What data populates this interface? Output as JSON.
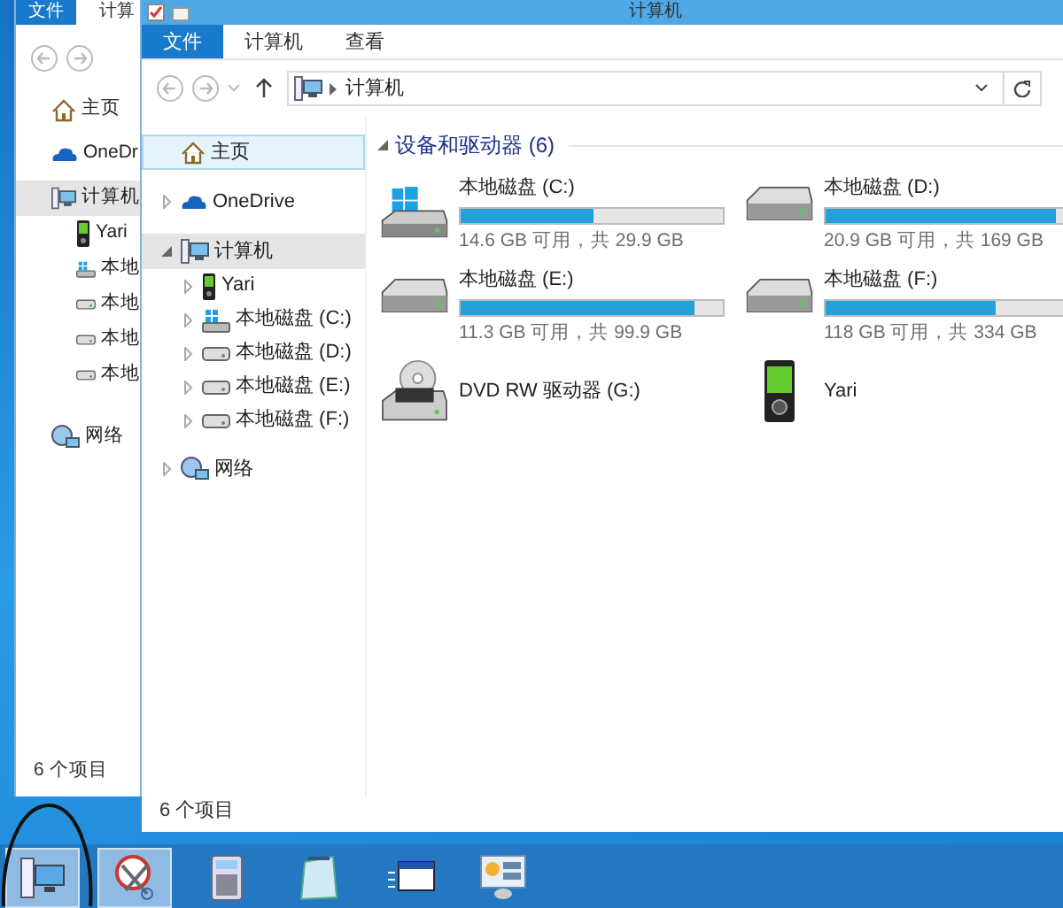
{
  "back_window": {
    "ribbon_tabs": [
      {
        "label": "文件",
        "selected": true
      },
      {
        "label": "计算",
        "selected": false
      }
    ],
    "nav_items": [
      {
        "label": "主页",
        "kind": "home",
        "selected": false
      },
      {
        "label": "OneDr",
        "kind": "cloud",
        "selected": false
      },
      {
        "label": "计算机",
        "kind": "computer",
        "selected": true,
        "children": [
          {
            "label": "Yari",
            "kind": "phone",
            "selected": false
          },
          {
            "label": "本地",
            "kind": "system-drive",
            "selected": false
          },
          {
            "label": "本地",
            "kind": "drive",
            "selected": false
          },
          {
            "label": "本地",
            "kind": "drive",
            "selected": false
          },
          {
            "label": "本地",
            "kind": "drive",
            "selected": false
          }
        ]
      },
      {
        "label": "网络",
        "kind": "network",
        "selected": false
      }
    ],
    "status": "6 个项目"
  },
  "window": {
    "title": "计算机",
    "ribbon_tabs": [
      {
        "label": "文件",
        "selected": true
      },
      {
        "label": "计算机",
        "selected": false
      },
      {
        "label": "查看",
        "selected": false
      }
    ],
    "address": "计算机",
    "nav_tree": [
      {
        "label": "主页",
        "kind": "home",
        "selected": true,
        "hovered": false
      },
      {
        "label": "OneDrive",
        "kind": "cloud",
        "selected": false,
        "hovered": false,
        "expanded": false
      },
      {
        "label": "计算机",
        "kind": "computer",
        "selected": false,
        "hovered": true,
        "expanded": true,
        "children": [
          {
            "label": "Yari",
            "kind": "phone",
            "selected": false,
            "hovered": false,
            "expanded": false
          },
          {
            "label": "本地磁盘 (C:)",
            "kind": "system-drive",
            "selected": false,
            "hovered": false,
            "expanded": false
          },
          {
            "label": "本地磁盘 (D:)",
            "kind": "drive",
            "selected": false,
            "hovered": false,
            "expanded": false
          },
          {
            "label": "本地磁盘 (E:)",
            "kind": "drive",
            "selected": false,
            "hovered": false,
            "expanded": false
          },
          {
            "label": "本地磁盘 (F:)",
            "kind": "drive",
            "selected": false,
            "hovered": false,
            "expanded": false
          }
        ]
      },
      {
        "label": "网络",
        "kind": "network",
        "selected": false,
        "hovered": false,
        "expanded": false
      }
    ],
    "section": {
      "title": "设备和驱动器 (6)",
      "expanded": true
    },
    "drives": [
      {
        "kind": "system-disk",
        "name": "本地磁盘 (C:)",
        "level": 0.51,
        "info": "14.6 GB 可用，共 29.9 GB"
      },
      {
        "kind": "disk",
        "name": "本地磁盘 (D:)",
        "level": 0.88,
        "info": "20.9 GB 可用，共 169 GB"
      },
      {
        "kind": "disk",
        "name": "本地磁盘 (E:)",
        "level": 0.89,
        "info": "11.3 GB 可用，共 99.9 GB"
      },
      {
        "kind": "disk",
        "name": "本地磁盘 (F:)",
        "level": 0.65,
        "info": "118 GB 可用，共 334 GB"
      },
      {
        "kind": "dvd",
        "name": "DVD RW 驱动器 (G:)"
      },
      {
        "kind": "phone",
        "name": "Yari"
      }
    ],
    "status": "6 个项目"
  },
  "taskbar": {
    "items": [
      {
        "kind": "computer",
        "running": true
      },
      {
        "kind": "scissors",
        "running": true
      },
      {
        "kind": "calculator",
        "running": false
      },
      {
        "kind": "notepad",
        "running": false
      },
      {
        "kind": "window",
        "running": false
      },
      {
        "kind": "panel",
        "running": false
      }
    ]
  }
}
